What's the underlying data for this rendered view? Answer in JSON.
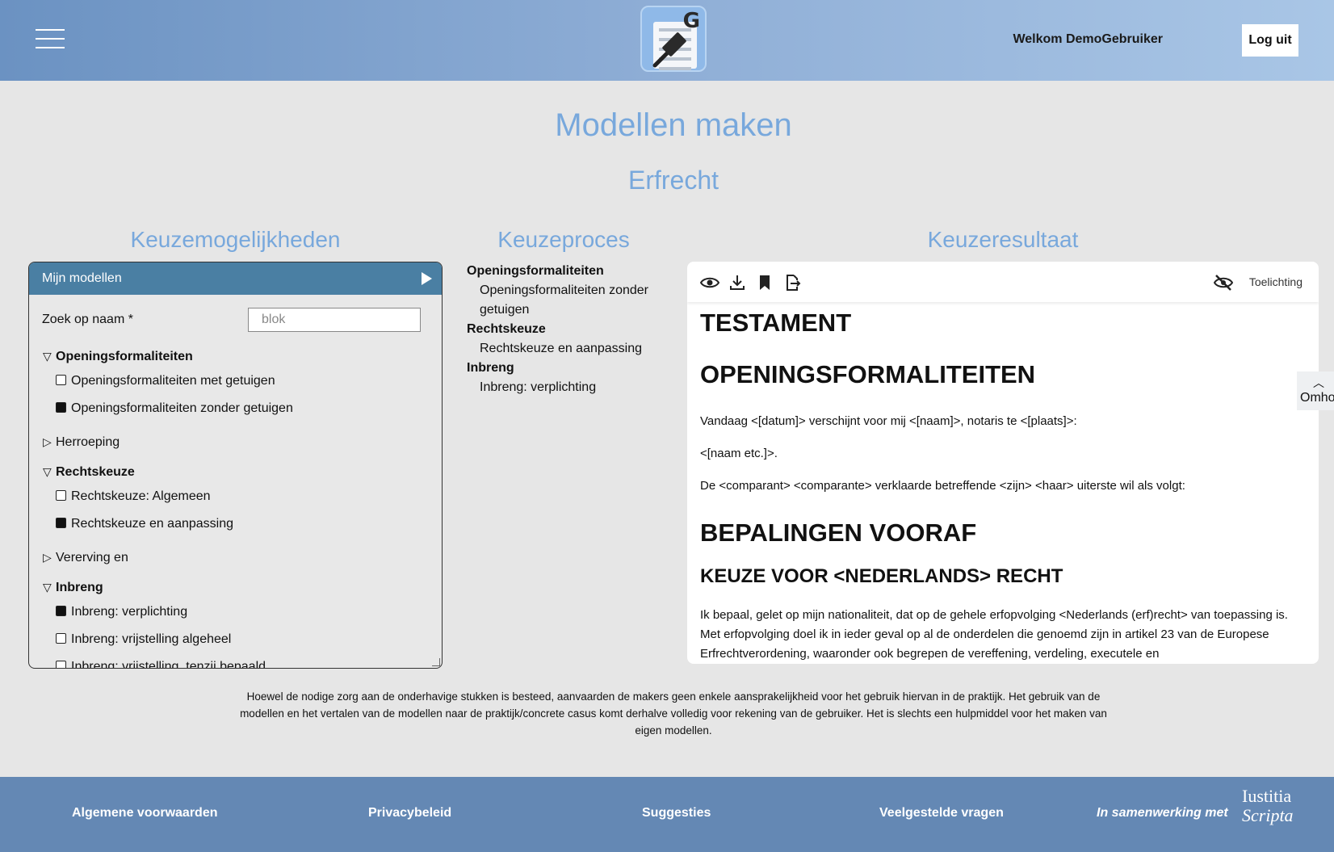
{
  "header": {
    "welcome": "Welkom DemoGebruiker",
    "logout": "Log uit",
    "logo_letter": "G"
  },
  "titles": {
    "main": "Modellen maken",
    "sub": "Erfrecht",
    "col_left": "Keuzemogelijkheden",
    "col_mid": "Keuzeproces",
    "col_right": "Keuzeresultaat"
  },
  "panel": {
    "head": "Mijn modellen",
    "search_label": "Zoek op naam *",
    "search_placeholder": "blok",
    "groups": [
      {
        "label": "Openingsformaliteiten",
        "open": true
      },
      {
        "label": "Openingsformaliteiten met getuigen",
        "checked": false
      },
      {
        "label": "Openingsformaliteiten zonder getuigen",
        "checked": true
      },
      {
        "label": "Herroeping",
        "open": false
      },
      {
        "label": "Rechtskeuze",
        "open": true
      },
      {
        "label": "Rechtskeuze: Algemeen",
        "checked": false
      },
      {
        "label": "Rechtskeuze en aanpassing",
        "checked": true
      },
      {
        "label": "Vererving en",
        "open": false
      },
      {
        "label": "Inbreng",
        "open": true
      },
      {
        "label": "Inbreng: verplichting",
        "checked": true
      },
      {
        "label": "Inbreng: vrijstelling algeheel",
        "checked": false
      },
      {
        "label": "Inbreng: vrijstelling, tenzij bepaald",
        "checked": false
      }
    ]
  },
  "process": {
    "h1": "Openingsformaliteiten",
    "c1": "Openingsformaliteiten zonder getuigen",
    "h2": "Rechtskeuze",
    "c2": "Rechtskeuze en aanpassing",
    "h3": "Inbreng",
    "c3": "Inbreng: verplichting"
  },
  "doc": {
    "toelichting": "Toelichting",
    "h_testament": "TESTAMENT",
    "h_opening": "OPENINGSFORMALITEITEN",
    "p1": "Vandaag <[datum]> verschijnt voor mij <[naam]>, notaris te <[plaats]>:",
    "p2": "<[naam etc.]>.",
    "p3": "De <comparant> <comparante> verklaarde betreffende <zijn> <haar> uiterste wil als volgt:",
    "h_bepalingen": "BEPALINGEN VOORAF",
    "h_keuze": "KEUZE VOOR <NEDERLANDS> RECHT",
    "p4": "Ik bepaal, gelet op mijn nationaliteit, dat op de gehele erfopvolging <Nederlands (erf)recht> van toepassing is. Met erfopvolging doel ik in ieder geval op al de onderdelen die genoemd zijn in artikel 23 van de Europese Erfrechtverordening, waaronder ook begrepen de vereffening, verdeling, executele en"
  },
  "side_tab": "Omhoog",
  "disclaimer": "Hoewel de nodige zorg aan de onderhavige stukken is besteed, aanvaarden de makers geen enkele aansprakelijkheid voor het gebruik hiervan in de praktijk. Het gebruik van de modellen en het vertalen van de modellen naar de praktijk/concrete casus komt derhalve volledig voor rekening van de gebruiker. Het is slechts een hulpmiddel voor het maken van eigen modellen.",
  "footer": {
    "link1": "Algemene voorwaarden",
    "link2": "Privacybeleid",
    "link3": "Suggesties",
    "link4": "Veelgestelde vragen",
    "collab": "In samenwerking met",
    "brand1": "Iustitia",
    "brand2": "Scripta"
  }
}
